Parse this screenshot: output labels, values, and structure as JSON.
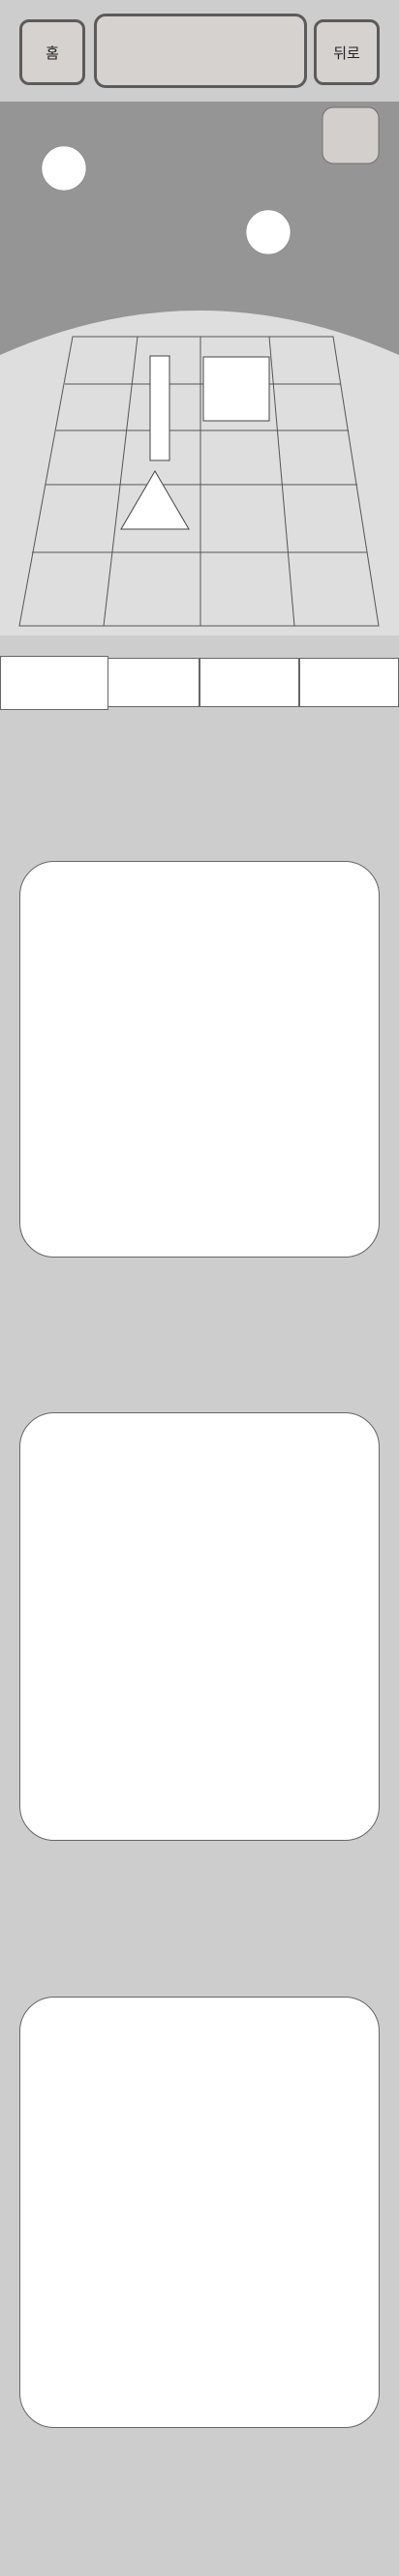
{
  "header": {
    "home_label": "홈",
    "back_label": "뒤로"
  },
  "colors": {
    "sky": "#959595",
    "ground": "#dedede",
    "page_background": "#cdcdcd",
    "button_fill": "#d6d2d0"
  },
  "scene": {
    "grid": {
      "rows": 5,
      "columns": 4
    },
    "objects": [
      "tall-rectangle",
      "square",
      "triangle"
    ],
    "lights": 2
  },
  "option_tabs": {
    "count": 4,
    "selected_index": 0
  },
  "panels": {
    "count": 3
  }
}
